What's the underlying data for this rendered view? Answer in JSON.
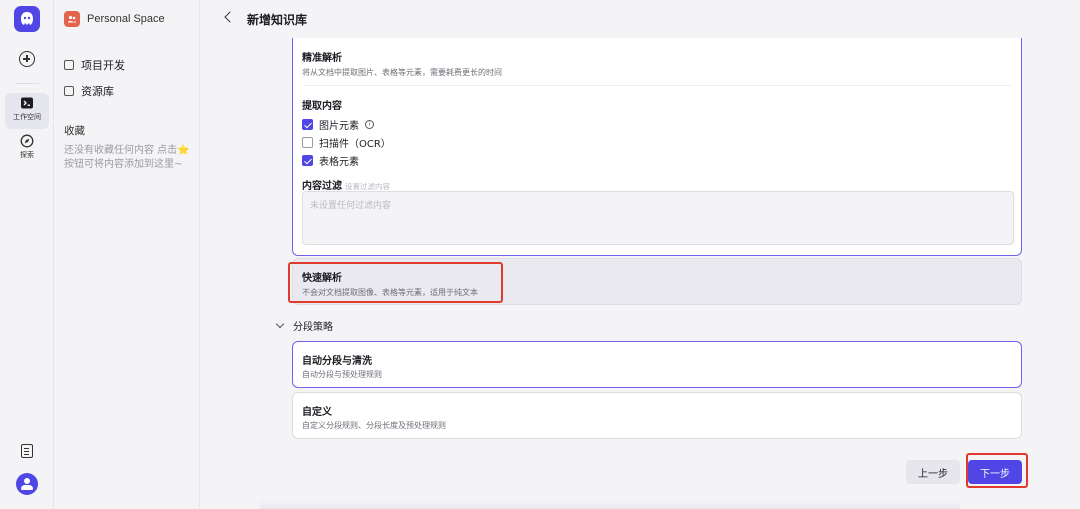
{
  "rail": {
    "active_label": "工作空间",
    "explore_label": "探索"
  },
  "sidebar": {
    "space_name": "Personal Space",
    "items": [
      {
        "label": "项目开发"
      },
      {
        "label": "资源库"
      }
    ],
    "favorites_title": "收藏",
    "favorites_empty": "还没有收藏任何内容 点击⭐按钮可将内容添加到这里~"
  },
  "header": {
    "title": "新增知识库"
  },
  "parse": {
    "precise": {
      "title": "精准解析",
      "desc": "将从文档中提取图片、表格等元素，需要耗费更长的时间"
    },
    "extract_title": "提取内容",
    "extract_options": [
      {
        "label": "图片元素",
        "checked": true
      },
      {
        "label": "扫描件（OCR）",
        "checked": false
      },
      {
        "label": "表格元素",
        "checked": true
      }
    ],
    "filter_title": "内容过滤",
    "filter_hint": "设置过滤内容",
    "filter_placeholder": "未设置任何过滤内容",
    "fast": {
      "title": "快速解析",
      "desc": "不会对文档提取图像、表格等元素，适用于纯文本"
    }
  },
  "segment": {
    "title": "分段策略",
    "options": [
      {
        "title": "自动分段与清洗",
        "desc": "自动分段与预处理规则",
        "selected": true
      },
      {
        "title": "自定义",
        "desc": "自定义分段规则、分段长度及预处理规则",
        "selected": false
      }
    ]
  },
  "footer": {
    "prev_label": "上一步",
    "next_label": "下一步"
  },
  "colors": {
    "accent": "#4f46e5",
    "highlight": "#e03a2f",
    "selected_border": "#6d63f0"
  },
  "icons": [
    "app-logo-icon",
    "plus-icon",
    "terminal-icon",
    "compass-icon",
    "document-icon",
    "user-avatar-icon",
    "people-icon",
    "chevron-left-icon",
    "chevron-down-icon",
    "info-icon"
  ]
}
